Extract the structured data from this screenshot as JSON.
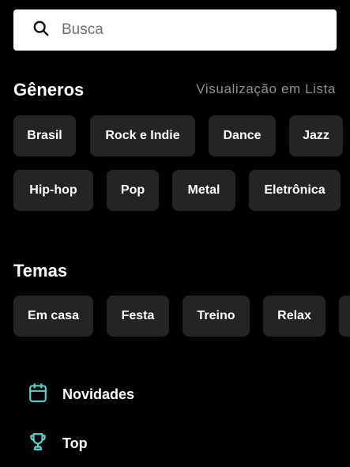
{
  "search": {
    "placeholder": "Busca"
  },
  "genres": {
    "title": "Gêneros",
    "list_view_label": "Visualização em Lista",
    "row1": [
      "Brasil",
      "Rock e Indie",
      "Dance",
      "Jazz"
    ],
    "row2": [
      "Hip-hop",
      "Pop",
      "Metal",
      "Eletrônica"
    ]
  },
  "themes": {
    "title": "Temas",
    "items": [
      "Em casa",
      "Festa",
      "Treino",
      "Relax"
    ]
  },
  "nav": {
    "novidades": "Novidades",
    "top": "Top"
  },
  "colors": {
    "background": "#000000",
    "chip": "#242424",
    "accent_icon": "#5fd3c9",
    "secondary_text": "#8f8f8f"
  },
  "icons": {
    "search": "search-icon",
    "novidades": "calendar-icon",
    "top": "trophy-icon"
  }
}
